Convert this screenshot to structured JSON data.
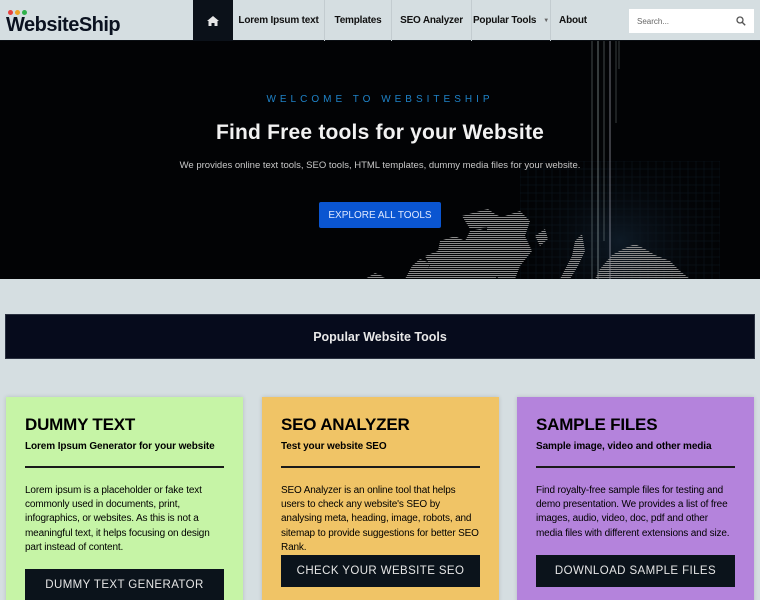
{
  "brand": {
    "name": "WebsiteShip",
    "dot_colors": [
      "#e8413c",
      "#f0a422",
      "#2fb24b"
    ]
  },
  "nav": {
    "home_icon": "home-icon",
    "items": [
      {
        "label": "Lorem Ipsum text"
      },
      {
        "label": "Templates"
      },
      {
        "label": "SEO Analyzer"
      },
      {
        "label": "Popular Tools",
        "has_dropdown": true,
        "caret": "▼"
      },
      {
        "label": "About"
      }
    ]
  },
  "search": {
    "placeholder": "Search...",
    "value": "",
    "icon": "search-icon"
  },
  "hero": {
    "eyebrow": "WELCOME TO WEBSITESHIP",
    "title": "Find Free tools for your Website",
    "subtitle": "We provides online text tools, SEO tools, HTML templates, dummy media files for your website.",
    "cta_label": "EXPLORE ALL TOOLS"
  },
  "section": {
    "title": "Popular Website Tools"
  },
  "cards": [
    {
      "title": "DUMMY TEXT",
      "subtitle": "Lorem Ipsum Generator for your website",
      "body": "Lorem ipsum is a placeholder or fake text commonly used in documents, print, infographics, or websites. As this is not a meaningful text, it helps focusing on design part instead of content.",
      "button": "DUMMY TEXT GENERATOR",
      "color": "#c6f4a6"
    },
    {
      "title": "SEO ANALYZER",
      "subtitle": "Test your website SEO",
      "body": "SEO Analyzer is an online tool that helps users to check any website's SEO by analysing meta, heading, image, robots, and sitemap to provide suggestions for better SEO Rank.",
      "button": "CHECK YOUR WEBSITE SEO",
      "color": "#f0c466"
    },
    {
      "title": "SAMPLE FILES",
      "subtitle": "Sample image, video and other media",
      "body": "Find royalty-free sample files for testing and demo presentation. We provides a list of free images, audio, video, doc, pdf and other media files with different extensions and size.",
      "button": "DOWNLOAD SAMPLE FILES",
      "color": "#b483dc"
    }
  ]
}
